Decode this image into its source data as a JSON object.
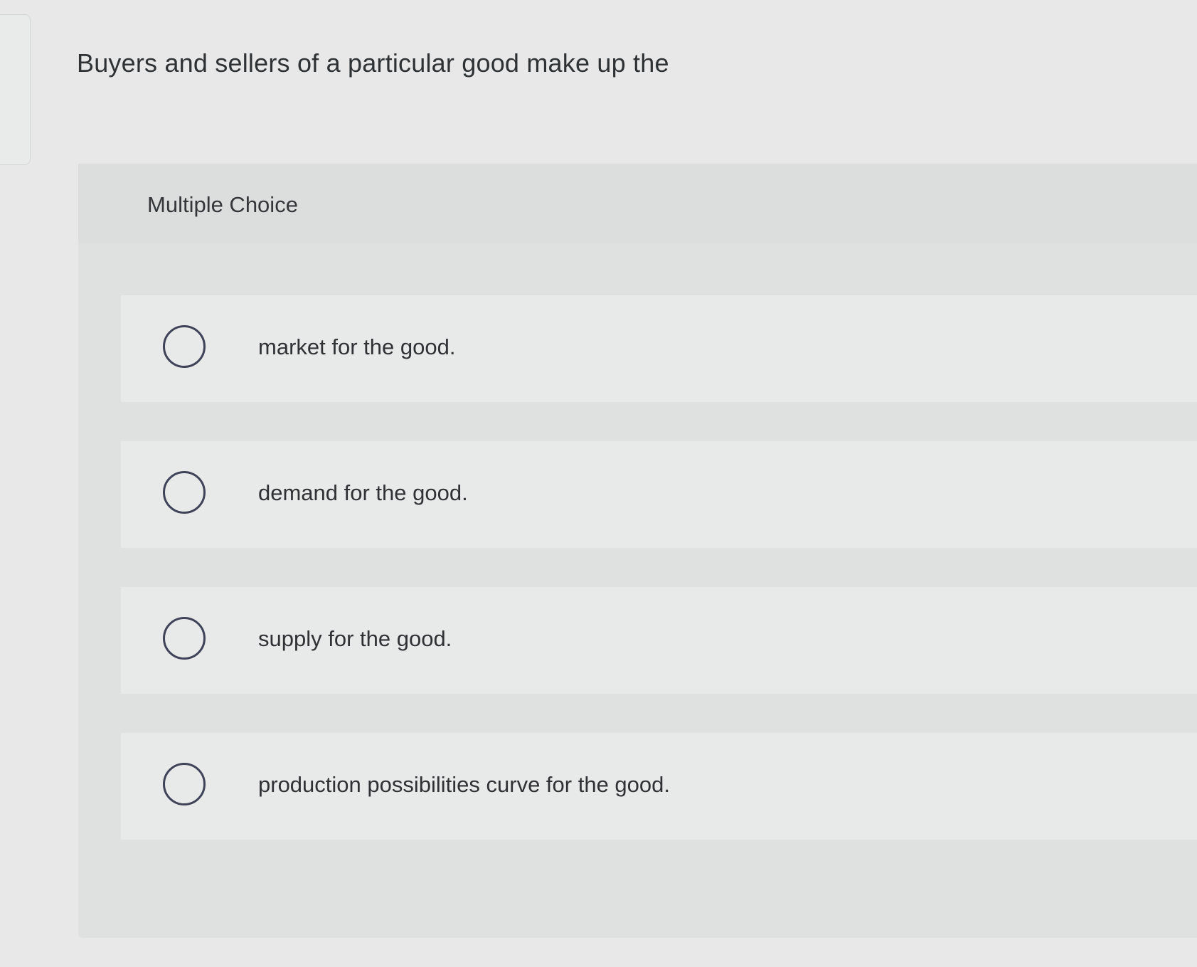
{
  "question": {
    "text": "Buyers and sellers of a particular good make up the"
  },
  "answer_panel": {
    "label": "Multiple Choice",
    "options": [
      {
        "label": "market for the good.",
        "selected": false
      },
      {
        "label": "demand for the good.",
        "selected": false
      },
      {
        "label": "supply for the good.",
        "selected": false
      },
      {
        "label": "production possibilities curve for the good.",
        "selected": false
      }
    ]
  },
  "colors": {
    "background": "#e7e8e7",
    "panel": "#dfe1e1",
    "option_row": "#e8e9e9",
    "radio_border": "#3e4357",
    "text": "#2f3235"
  }
}
